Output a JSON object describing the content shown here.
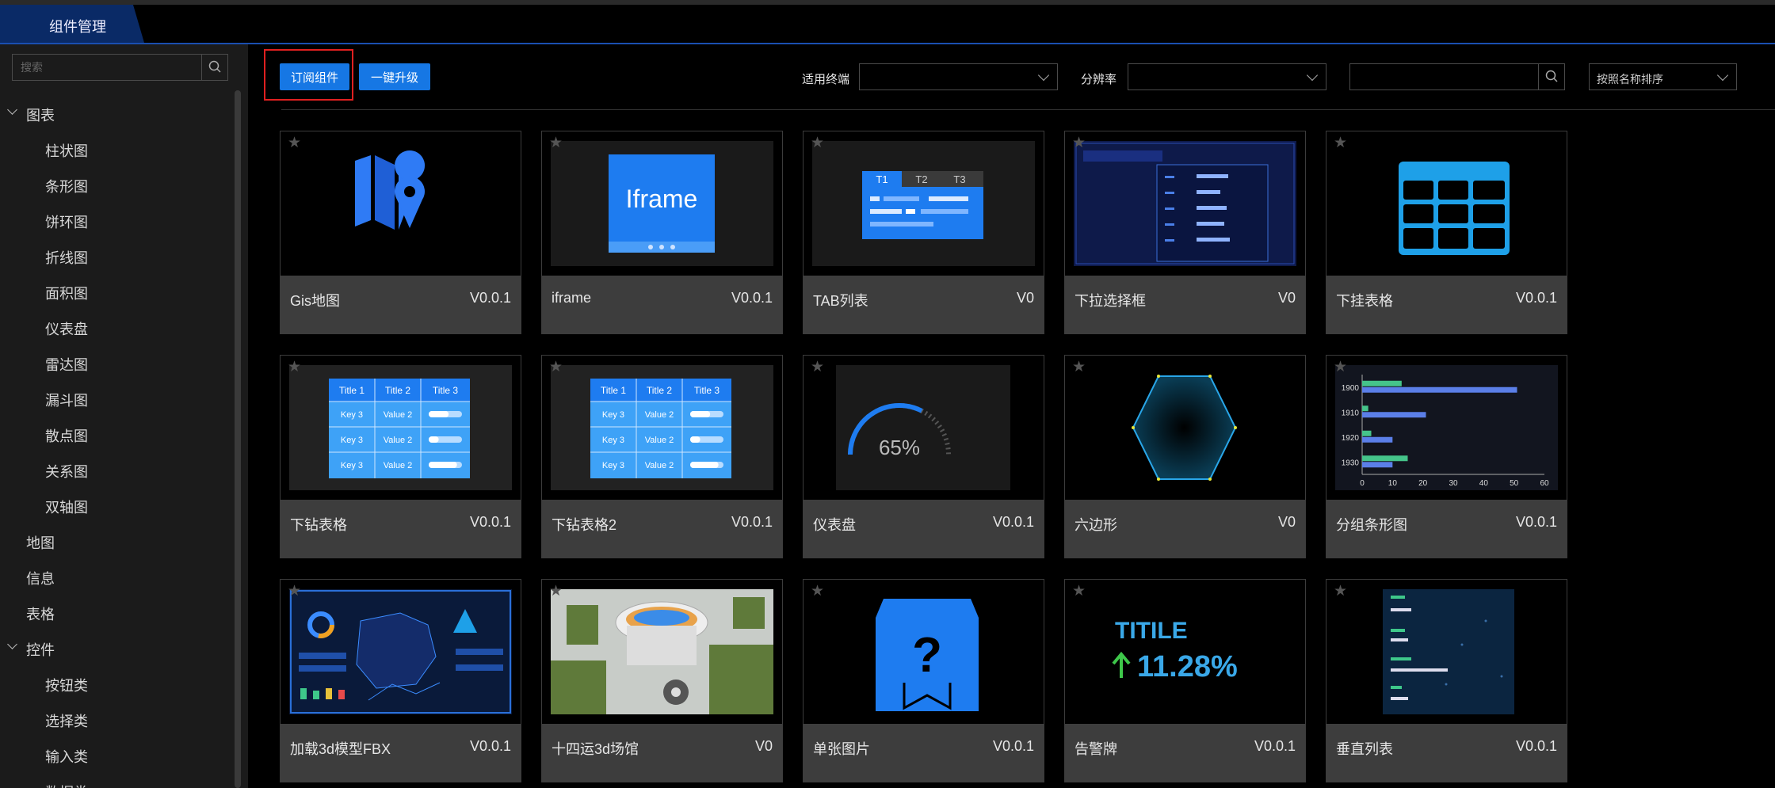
{
  "header": {
    "tab_label": "组件管理"
  },
  "sidebar": {
    "search_placeholder": "搜索",
    "tree": [
      {
        "label": "图表",
        "level": 0,
        "expanded": true
      },
      {
        "label": "柱状图",
        "level": 1
      },
      {
        "label": "条形图",
        "level": 1
      },
      {
        "label": "饼环图",
        "level": 1
      },
      {
        "label": "折线图",
        "level": 1
      },
      {
        "label": "面积图",
        "level": 1
      },
      {
        "label": "仪表盘",
        "level": 1
      },
      {
        "label": "雷达图",
        "level": 1
      },
      {
        "label": "漏斗图",
        "level": 1
      },
      {
        "label": "散点图",
        "level": 1
      },
      {
        "label": "关系图",
        "level": 1
      },
      {
        "label": "双轴图",
        "level": 1
      },
      {
        "label": "地图",
        "level": 0
      },
      {
        "label": "信息",
        "level": 0
      },
      {
        "label": "表格",
        "level": 0
      },
      {
        "label": "控件",
        "level": 0,
        "expanded": true
      },
      {
        "label": "按钮类",
        "level": 1
      },
      {
        "label": "选择类",
        "level": 1
      },
      {
        "label": "输入类",
        "level": 1
      },
      {
        "label": "数据类",
        "level": 1
      }
    ]
  },
  "toolbar": {
    "subscribe_label": "订阅组件",
    "upgrade_label": "一键升级",
    "terminal_label": "适用终端",
    "terminal_value": "",
    "resolution_label": "分辨率",
    "resolution_value": "",
    "search_value": "",
    "sort_value": "按照名称排序"
  },
  "cards": [
    {
      "name": "Gis地图",
      "version": "V0.0.1",
      "thumb": "gis-map"
    },
    {
      "name": "iframe",
      "version": "V0.0.1",
      "thumb": "iframe",
      "thumb_text": "Iframe"
    },
    {
      "name": "TAB列表",
      "version": "V0",
      "thumb": "tab-list",
      "thumb_tabs": [
        "T1",
        "T2",
        "T3"
      ]
    },
    {
      "name": "下拉选择框",
      "version": "V0",
      "thumb": "dropdown"
    },
    {
      "name": "下挂表格",
      "version": "V0.0.1",
      "thumb": "grid-table"
    },
    {
      "name": "下钻表格",
      "version": "V0.0.1",
      "thumb": "drill-table"
    },
    {
      "name": "下钻表格2",
      "version": "V0.0.1",
      "thumb": "drill-table"
    },
    {
      "name": "仪表盘",
      "version": "V0.0.1",
      "thumb": "gauge",
      "thumb_text": "65%"
    },
    {
      "name": "六边形",
      "version": "V0",
      "thumb": "hexagon"
    },
    {
      "name": "分组条形图",
      "version": "V0.0.1",
      "thumb": "grouped-bar"
    },
    {
      "name": "加载3d模型FBX",
      "version": "V0.0.1",
      "thumb": "dashboard-3d"
    },
    {
      "name": "十四运3d场馆",
      "version": "V0",
      "thumb": "stadium-3d"
    },
    {
      "name": "单张图片",
      "version": "V0.0.1",
      "thumb": "single-image"
    },
    {
      "name": "告警牌",
      "version": "V0.0.1",
      "thumb": "alarm",
      "thumb_title": "TITILE",
      "thumb_value": "11.28%"
    },
    {
      "name": "垂直列表",
      "version": "V0.0.1",
      "thumb": "vertical-list"
    }
  ],
  "drill_table": {
    "headers": [
      "Title 1",
      "Title 2",
      "Title 3"
    ],
    "rows": [
      [
        "Key 3",
        "Value 2"
      ],
      [
        "Key 3",
        "Value 2"
      ],
      [
        "Key 3",
        "Value 2"
      ]
    ],
    "fills": [
      0.6,
      0.3,
      0.85
    ]
  },
  "grouped_bar_chart": {
    "categories": [
      "1900",
      "1910",
      "1920",
      "1930"
    ],
    "series": [
      {
        "color": "#45c48a",
        "values": [
          13,
          2,
          3,
          15
        ]
      },
      {
        "color": "#5b7fe8",
        "values": [
          51,
          21,
          10,
          10
        ]
      }
    ],
    "x_ticks": [
      "0",
      "10",
      "20",
      "30",
      "40",
      "50",
      "60"
    ],
    "xlim": [
      0,
      60
    ]
  },
  "gauge": {
    "value": 0.65
  },
  "colors": {
    "accent": "#1677e4",
    "highlight": "#e02020",
    "card_footer": "#3d3d3d"
  }
}
